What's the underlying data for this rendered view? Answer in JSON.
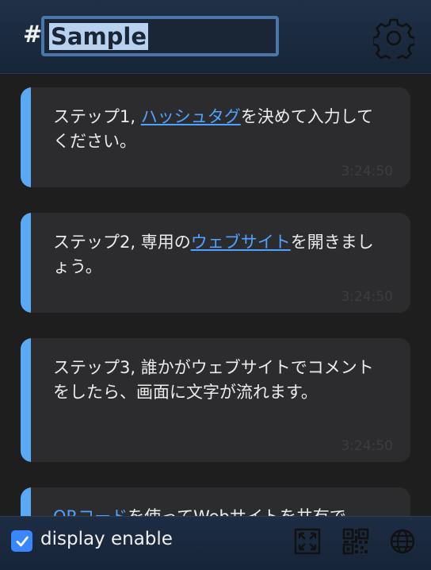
{
  "header": {
    "hash_symbol": "#",
    "hashtag_value": "Sample",
    "settings_icon": "gear-icon"
  },
  "feed": {
    "cards": [
      {
        "prefix": "ステップ1, ",
        "link": "ハッシュタグ",
        "suffix": "を決めて入力してください。",
        "time": "3:24:50"
      },
      {
        "prefix": "ステップ2, 専用の",
        "link": "ウェブサイト",
        "suffix": "を開きましょう。",
        "time": "3:24:50"
      },
      {
        "prefix": "ステップ3, 誰かがウェブサイトでコメントをしたら、画面に文字が流れます。",
        "link": "",
        "suffix": "",
        "time": "3:24:50"
      },
      {
        "prefix": "",
        "link": "QRコード",
        "suffix": "を使ってWebサイトを共有で",
        "time": ""
      }
    ]
  },
  "footer": {
    "display_enable_checked": true,
    "display_enable_label": "display enable",
    "icons": [
      "fullscreen-icon",
      "qr-code-icon",
      "globe-icon"
    ]
  },
  "colors": {
    "accent_bar": "#5aa9f5",
    "link": "#4da3ff",
    "header_bg": "#1f3047",
    "card_bg": "#2c2c2e"
  }
}
